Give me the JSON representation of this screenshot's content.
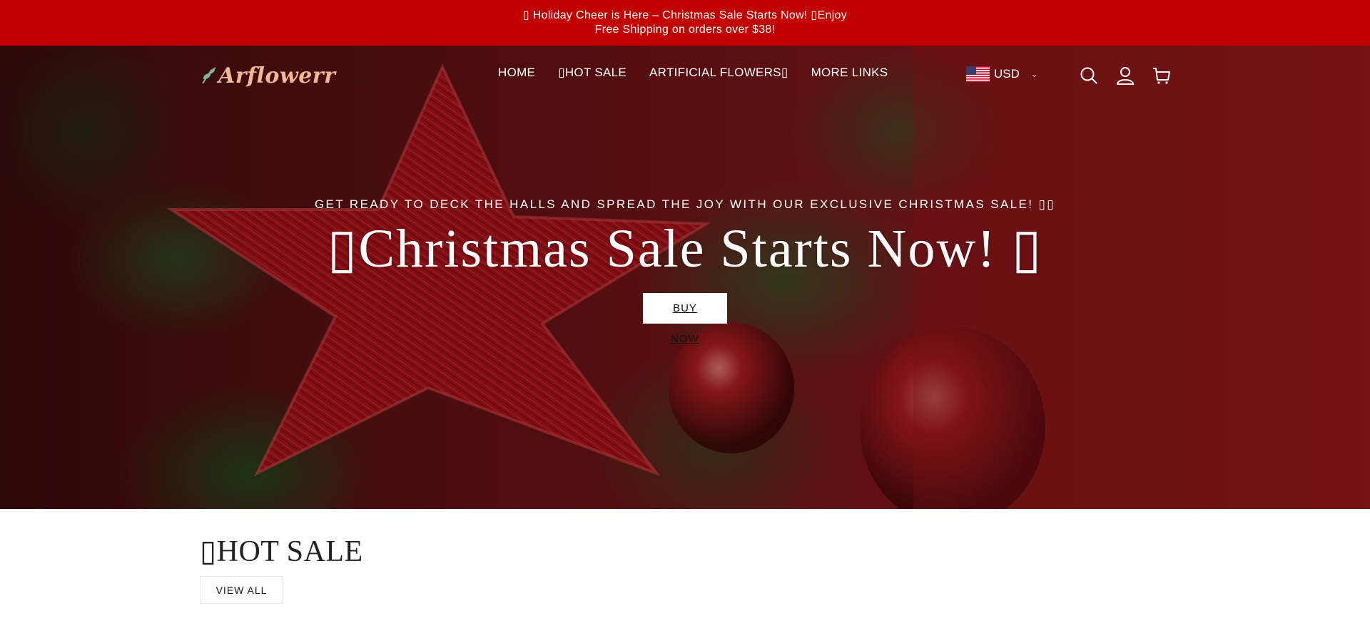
{
  "announcement": {
    "line1": "▯ Holiday Cheer is Here – Christmas Sale Starts Now! ▯Enjoy",
    "line2": "Free Shipping on orders over $38!"
  },
  "header": {
    "logo_text": "Arflowerr",
    "nav": [
      {
        "label": "HOME"
      },
      {
        "label": "▯HOT SALE"
      },
      {
        "label": "ARTIFICIAL FLOWERS▯"
      },
      {
        "label": "MORE LINKS"
      }
    ],
    "currency": {
      "label": "USD",
      "flag_icon": "us-flag-icon",
      "chevron_icon": "chevron-down-icon"
    },
    "icons": [
      "search-icon",
      "account-icon",
      "cart-icon"
    ]
  },
  "hero": {
    "subtitle": "GET READY TO DECK THE HALLS AND SPREAD THE JOY WITH OUR EXCLUSIVE CHRISTMAS SALE! ▯▯",
    "title": "▯Christmas Sale Starts Now! ▯",
    "button_label": "BUY NOW"
  },
  "hot_sale": {
    "title": "▯HOT SALE",
    "view_all_label": "VIEW ALL"
  },
  "colors": {
    "announcement_bg": "#c10000",
    "logo": "#f4b896"
  }
}
